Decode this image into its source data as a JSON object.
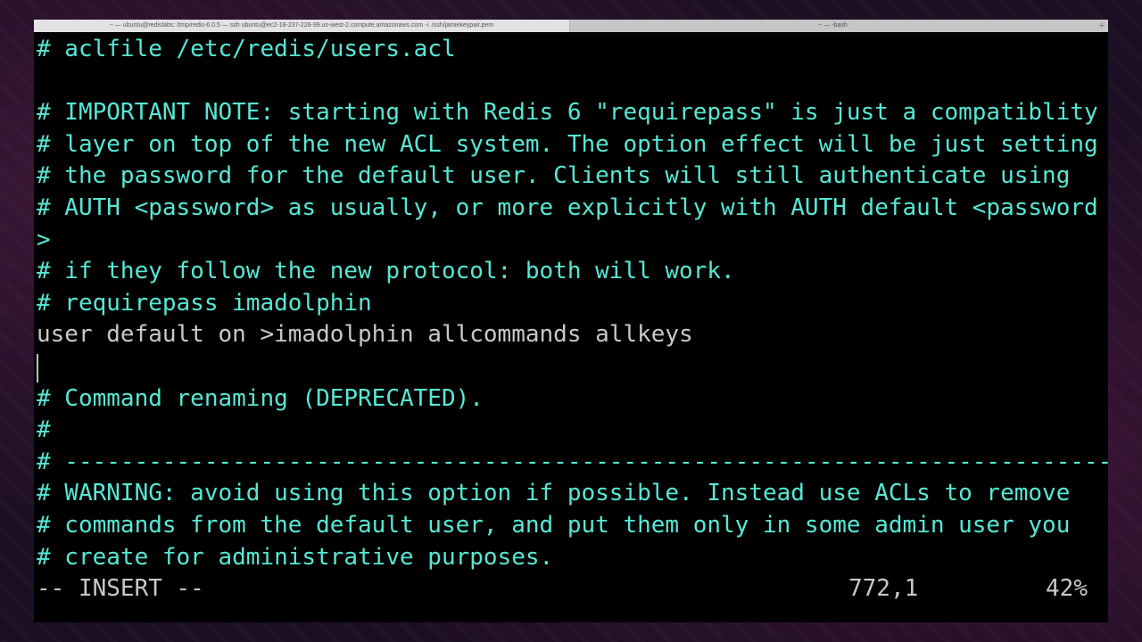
{
  "window": {
    "tabs": [
      {
        "label": "~ — ubuntu@redislabs: /tmp/redis-6.0.5 — ssh ubuntu@ec2-18-237-226-99.us-west-2.compute.amazonaws.com -i ./ssh/jamiekeypair.pem"
      },
      {
        "label": "~ — -bash"
      }
    ],
    "new_tab_icon": "plus-icon"
  },
  "editor": {
    "lines": [
      {
        "text": "# aclfile /etc/redis/users.acl",
        "style": "comment"
      },
      {
        "text": "",
        "style": "plain"
      },
      {
        "text": "# IMPORTANT NOTE: starting with Redis 6 \"requirepass\" is just a compatiblity",
        "style": "comment"
      },
      {
        "text": "# layer on top of the new ACL system. The option effect will be just setting",
        "style": "comment"
      },
      {
        "text": "# the password for the default user. Clients will still authenticate using",
        "style": "comment"
      },
      {
        "text": "# AUTH <password> as usually, or more explicitly with AUTH default <password",
        "style": "comment"
      },
      {
        "text": ">",
        "style": "comment"
      },
      {
        "text": "# if they follow the new protocol: both will work.",
        "style": "comment"
      },
      {
        "text": "# requirepass imadolphin",
        "style": "comment"
      },
      {
        "text": "user default on >imadolphin allcommands allkeys",
        "style": "plain"
      },
      {
        "text": "",
        "style": "plain"
      },
      {
        "text": "# Command renaming (DEPRECATED).",
        "style": "comment"
      },
      {
        "text": "#",
        "style": "comment"
      },
      {
        "text": "# ----------------------------------------------------------------------------",
        "style": "comment"
      },
      {
        "text": "# WARNING: avoid using this option if possible. Instead use ACLs to remove",
        "style": "comment"
      },
      {
        "text": "# commands from the default user, and put them only in some admin user you",
        "style": "comment"
      },
      {
        "text": "# create for administrative purposes.",
        "style": "comment"
      }
    ]
  },
  "status": {
    "mode": "-- INSERT --",
    "position": "772,1",
    "percent": "42%"
  },
  "colors": {
    "comment": "#56e8d6",
    "plain": "#c8c8c8",
    "background": "#000000"
  }
}
